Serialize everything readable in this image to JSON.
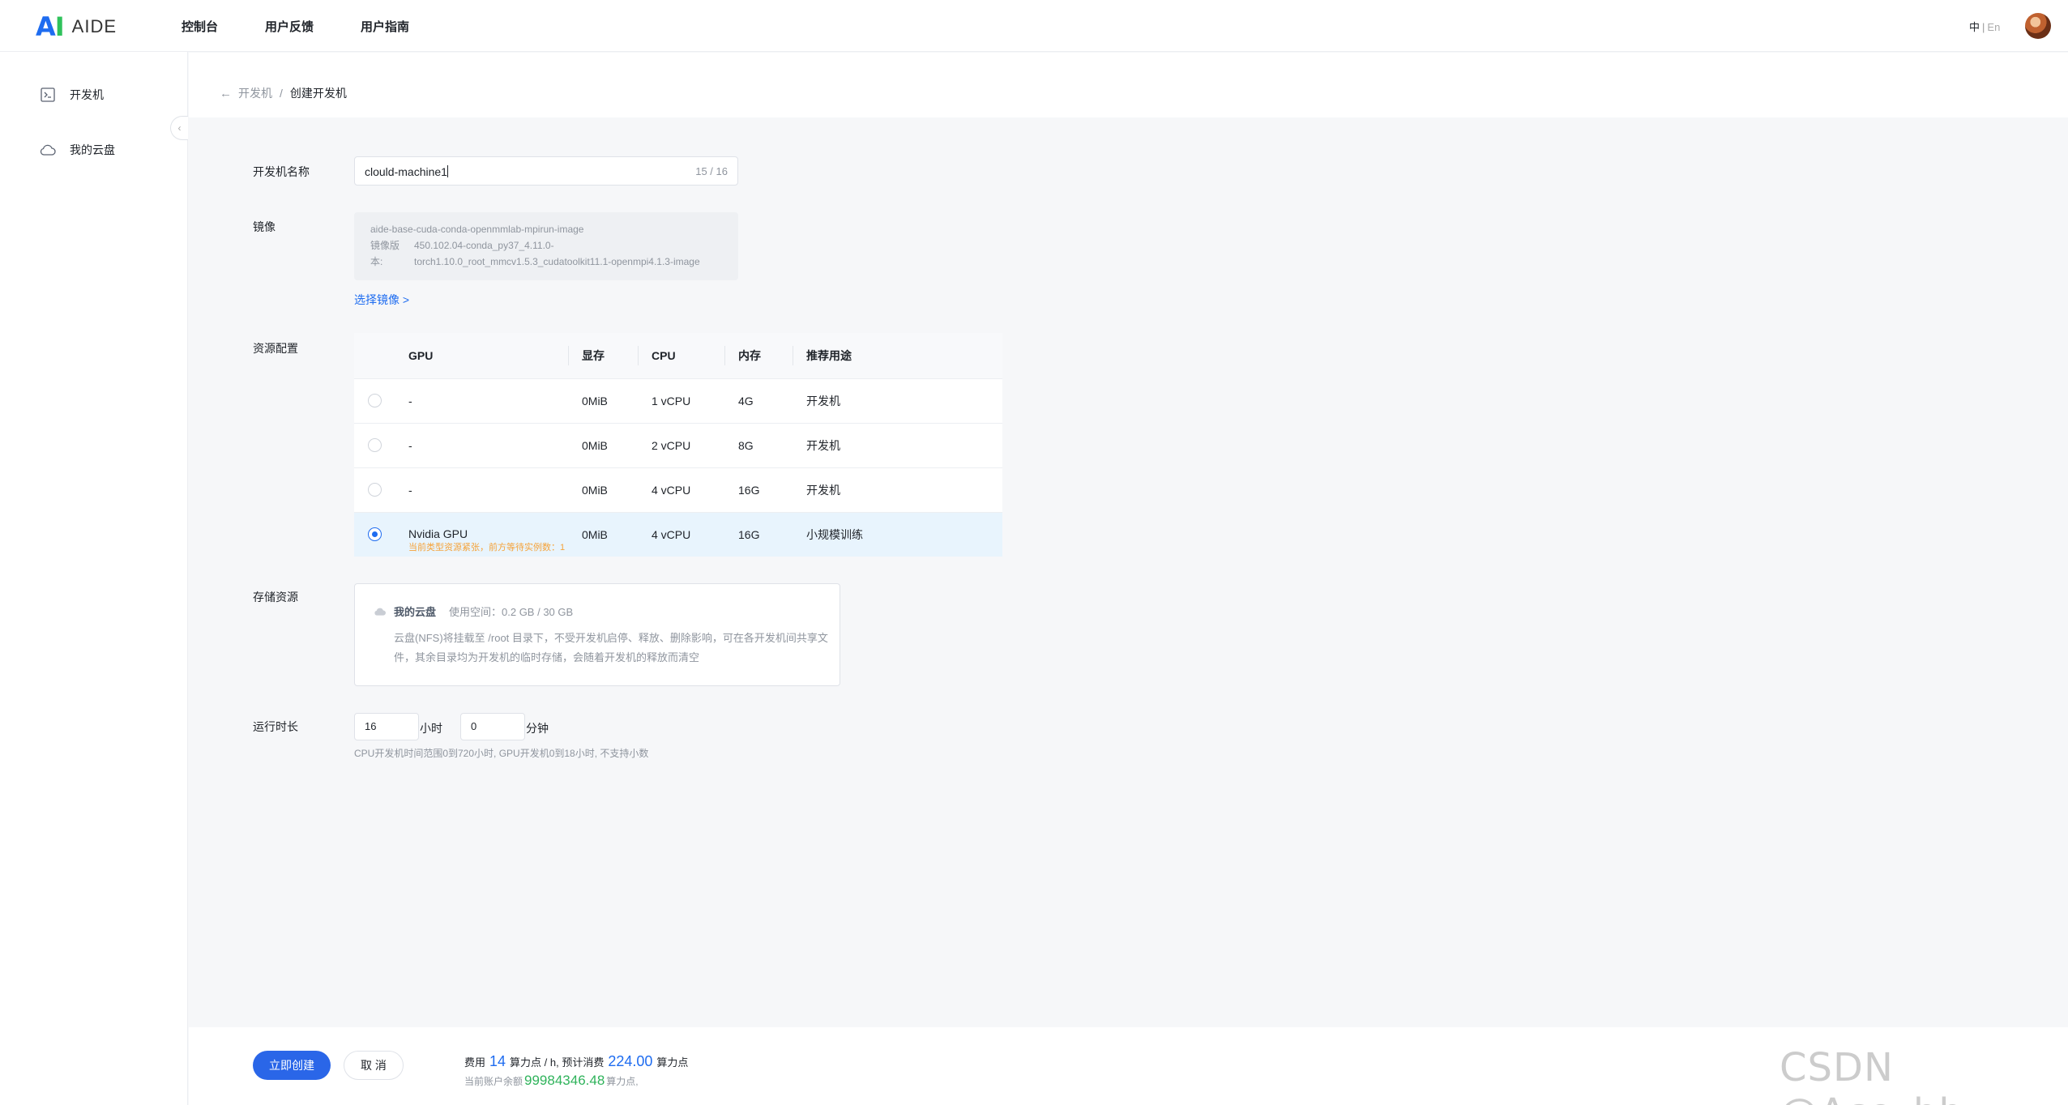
{
  "app": {
    "logo_mark": "AI",
    "logo_text": "AIDE"
  },
  "nav": [
    "控制台",
    "用户反馈",
    "用户指南"
  ],
  "lang": {
    "zh": "中",
    "sep": "|",
    "en": "En"
  },
  "sidebar": {
    "items": [
      {
        "label": "开发机",
        "icon": "terminal-icon"
      },
      {
        "label": "我的云盘",
        "icon": "cloud-icon"
      }
    ],
    "collapse_glyph": "‹"
  },
  "breadcrumb": {
    "back_glyph": "←",
    "parent": "开发机",
    "sep": "/",
    "current": "创建开发机"
  },
  "form": {
    "name": {
      "label": "开发机名称",
      "value": "clould-machine1",
      "count": "15 / 16"
    },
    "image": {
      "label": "镜像",
      "name": "aide-base-cuda-conda-openmmlab-mpirun-image",
      "version_label": "镜像版",
      "version_value": "450.102.04-conda_py37_4.11.0-",
      "version_label2": "本:",
      "version_value2": "torch1.10.0_root_mmcv1.5.3_cudatoolkit11.1-openmpi4.1.3-image",
      "select_link": "选择镜像 >"
    },
    "resource": {
      "label": "资源配置",
      "headers": {
        "gpu": "GPU",
        "vram": "显存",
        "cpu": "CPU",
        "mem": "内存",
        "use": "推荐用途"
      },
      "rows": [
        {
          "gpu": "-",
          "vram": "0MiB",
          "cpu": "1 vCPU",
          "mem": "4G",
          "use": "开发机",
          "selected": false
        },
        {
          "gpu": "-",
          "vram": "0MiB",
          "cpu": "2 vCPU",
          "mem": "8G",
          "use": "开发机",
          "selected": false
        },
        {
          "gpu": "-",
          "vram": "0MiB",
          "cpu": "4 vCPU",
          "mem": "16G",
          "use": "开发机",
          "selected": false
        },
        {
          "gpu": "Nvidia GPU",
          "vram": "0MiB",
          "cpu": "4 vCPU",
          "mem": "16G",
          "use": "小规模训练",
          "selected": true,
          "warning": "当前类型资源紧张，前方等待实例数：1"
        }
      ]
    },
    "storage": {
      "label": "存储资源",
      "name": "我的云盘",
      "usage": "使用空间：0.2 GB / 30 GB",
      "desc": "云盘(NFS)将挂载至 /root 目录下，不受开发机启停、释放、删除影响，可在各开发机间共享文件，其余目录均为开发机的临时存储，会随着开发机的释放而清空"
    },
    "duration": {
      "label": "运行时长",
      "hours": "16",
      "hours_unit": "小时",
      "minutes": "0",
      "minutes_unit": "分钟",
      "hint": "CPU开发机时间范围0到720小时, GPU开发机0到18小时, 不支持小数"
    }
  },
  "footer": {
    "create": "立即创建",
    "cancel": "取 消",
    "cost_prefix": "费用",
    "cost_rate": "14",
    "cost_unit": "算力点 / h, 预计消费",
    "cost_total": "224.00",
    "cost_total_unit": "算力点",
    "balance_prefix": "当前账户余额",
    "balance": "99984346.48",
    "balance_unit": "算力点,"
  },
  "watermark": "CSDN @Ace_bb",
  "colors": {
    "primary": "#2a66e8",
    "success": "#2fb35b",
    "warning": "#f5a33a"
  }
}
